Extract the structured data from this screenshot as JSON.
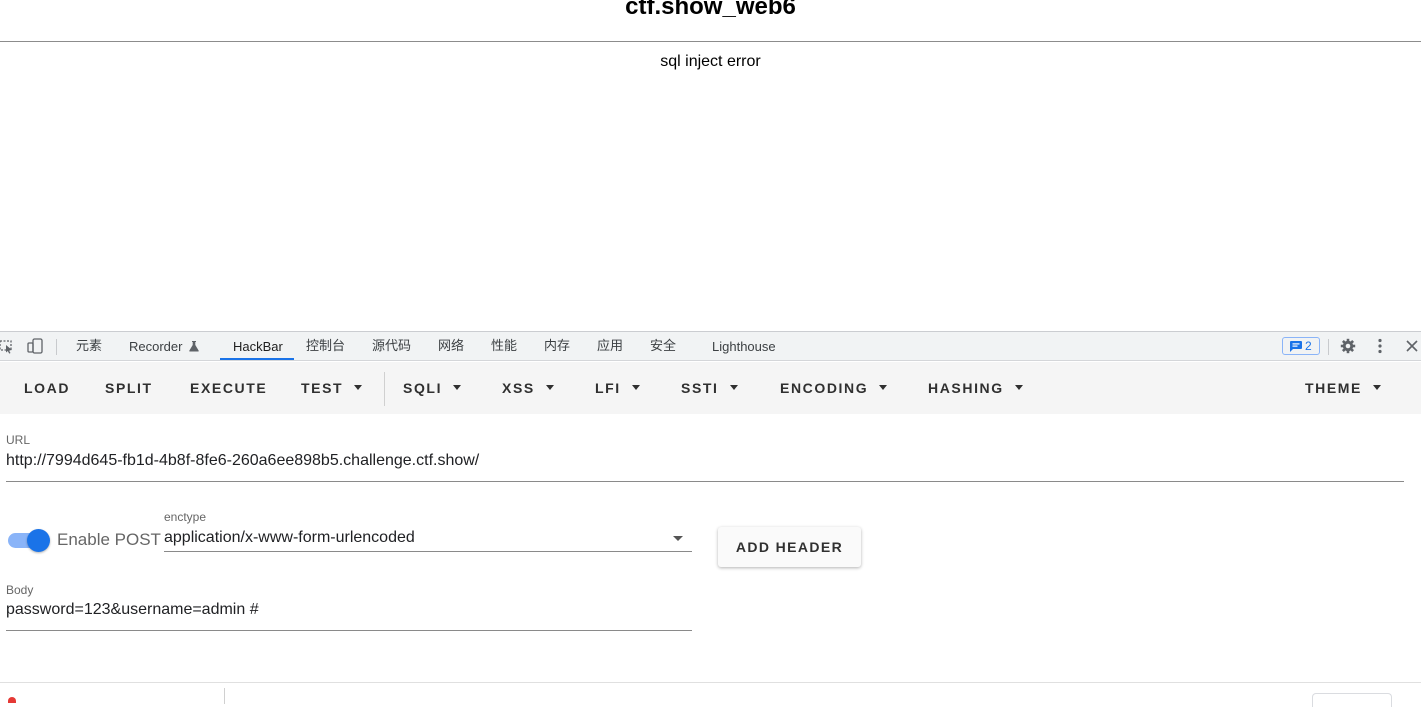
{
  "page": {
    "title": "ctf.show_web6",
    "message": "sql inject error"
  },
  "devtools": {
    "tabs": [
      {
        "label": "元素"
      },
      {
        "label": "Recorder"
      },
      {
        "label": "HackBar"
      },
      {
        "label": "控制台"
      },
      {
        "label": "源代码"
      },
      {
        "label": "网络"
      },
      {
        "label": "性能"
      },
      {
        "label": "内存"
      },
      {
        "label": "应用"
      },
      {
        "label": "安全"
      },
      {
        "label": "Lighthouse"
      }
    ],
    "active_tab": "HackBar",
    "issues_count": "2",
    "accent_color": "#1a73e8"
  },
  "hackbar": {
    "toolbar": {
      "load": "LOAD",
      "split": "SPLIT",
      "execute": "EXECUTE",
      "test": "TEST",
      "sqli": "SQLI",
      "xss": "XSS",
      "lfi": "LFI",
      "ssti": "SSTI",
      "encoding": "ENCODING",
      "hashing": "HASHING",
      "theme": "THEME"
    },
    "url": {
      "label": "URL",
      "value": "http://7994d645-fb1d-4b8f-8fe6-260a6ee898b5.challenge.ctf.show/"
    },
    "enable_post": {
      "label": "Enable POST",
      "checked": true
    },
    "enctype": {
      "label": "enctype",
      "value": "application/x-www-form-urlencoded"
    },
    "add_header_label": "ADD HEADER",
    "body": {
      "label": "Body",
      "value": "password=123&username=admin #"
    }
  }
}
